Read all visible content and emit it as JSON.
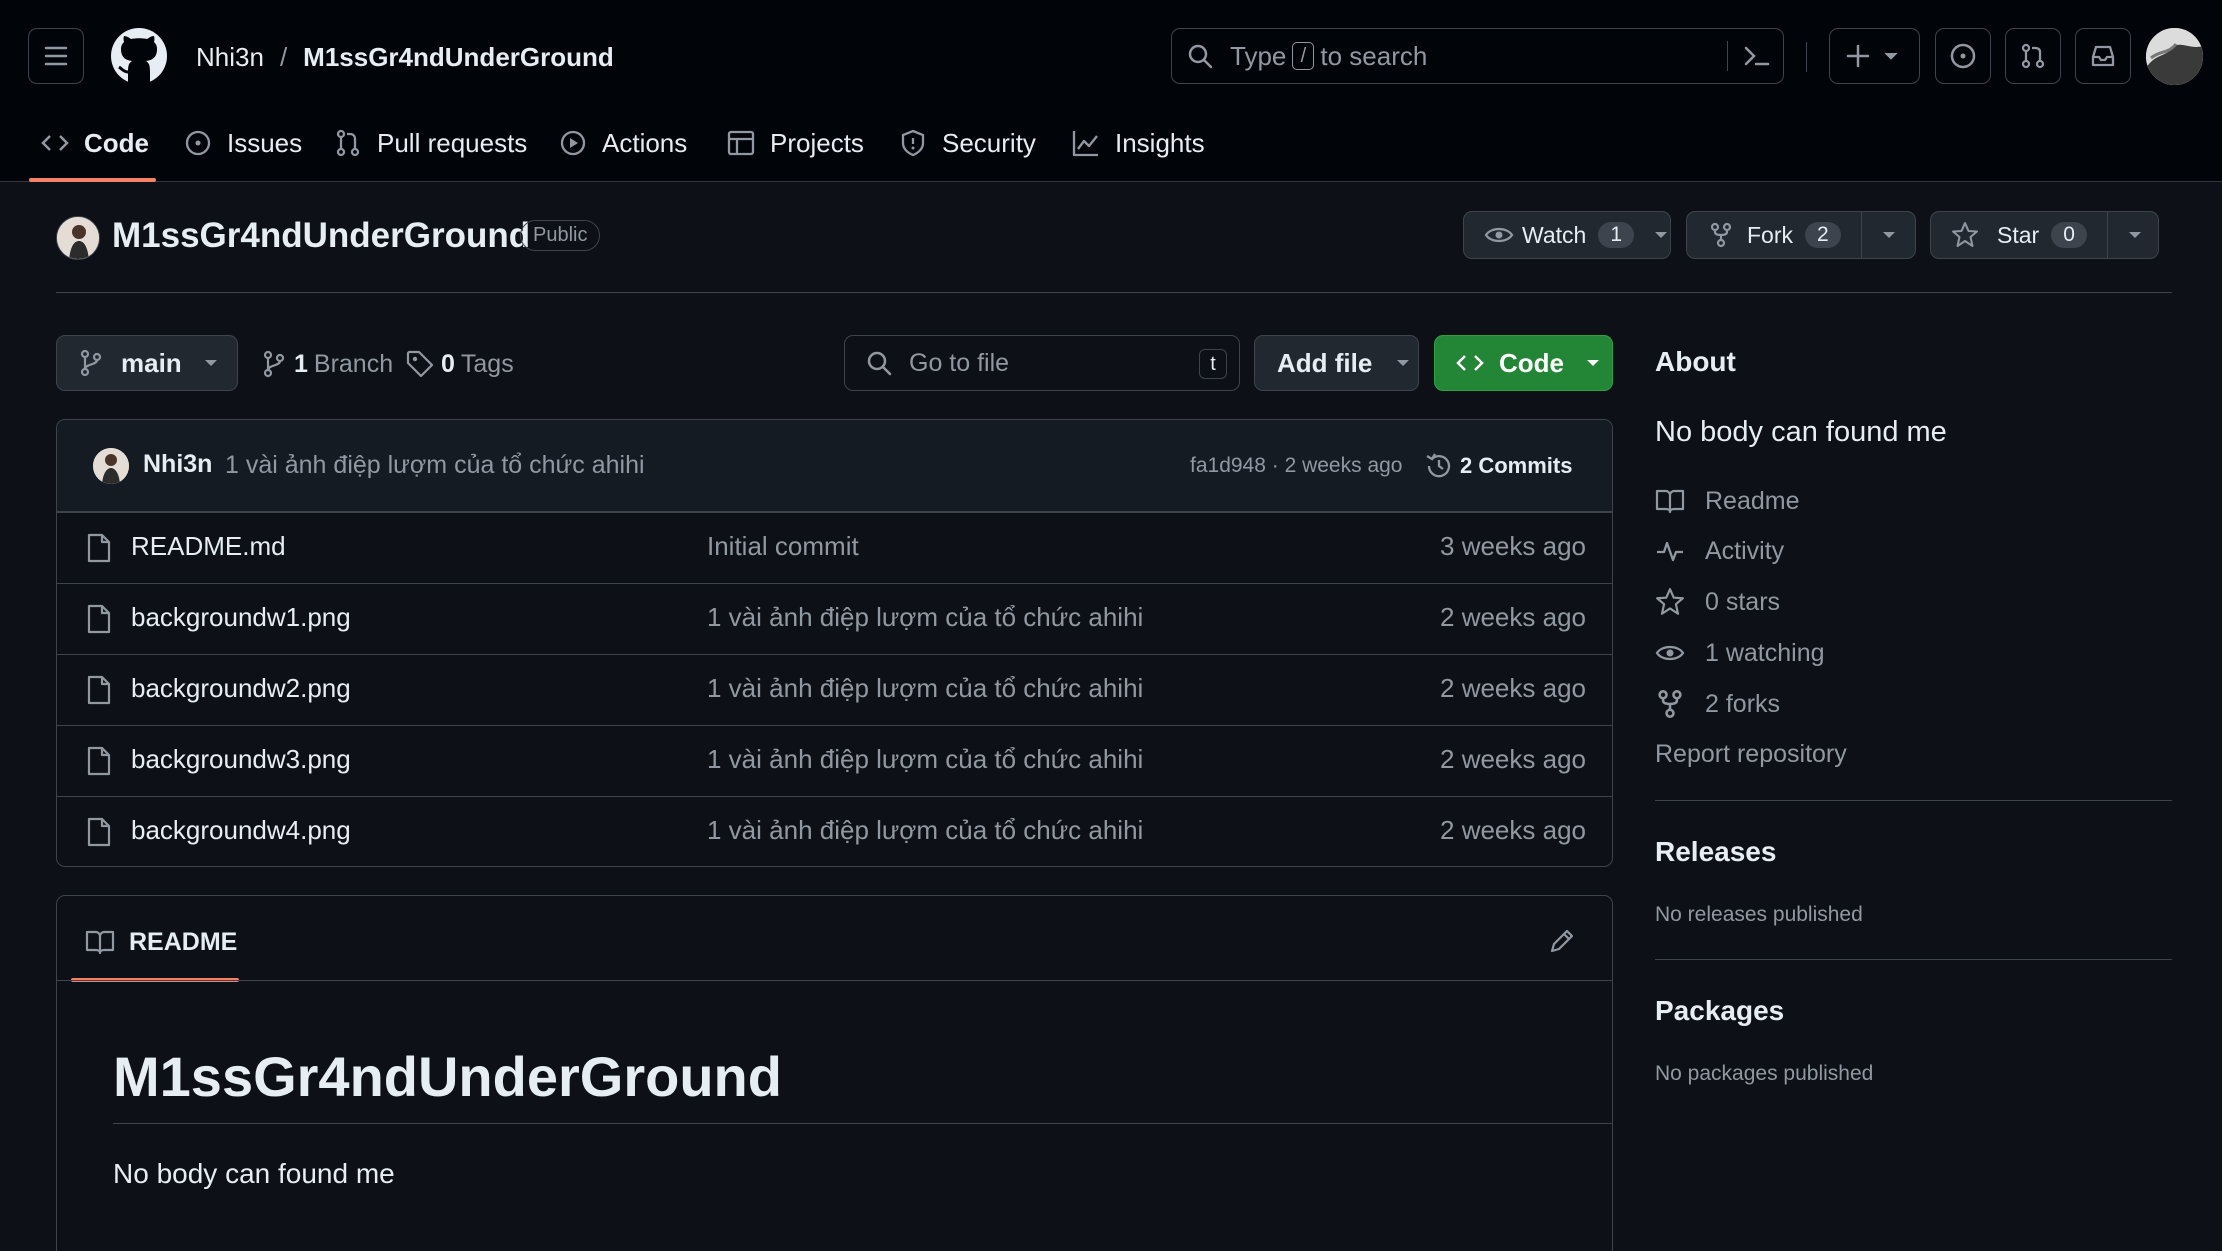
{
  "header": {
    "owner": "Nhi3n",
    "separator": "/",
    "repo": "M1ssGr4ndUnderGround",
    "search": {
      "prefix": "Type",
      "key": "/",
      "suffix": "to search"
    }
  },
  "nav": {
    "tabs": [
      {
        "label": "Code",
        "icon": "code-icon",
        "active": true
      },
      {
        "label": "Issues",
        "icon": "issue-icon"
      },
      {
        "label": "Pull requests",
        "icon": "pull-request-icon"
      },
      {
        "label": "Actions",
        "icon": "play-icon"
      },
      {
        "label": "Projects",
        "icon": "table-icon"
      },
      {
        "label": "Security",
        "icon": "shield-icon"
      },
      {
        "label": "Insights",
        "icon": "graph-icon"
      }
    ]
  },
  "repo": {
    "name": "M1ssGr4ndUnderGround",
    "visibility": "Public",
    "watch": {
      "label": "Watch",
      "count": "1"
    },
    "fork": {
      "label": "Fork",
      "count": "2"
    },
    "star": {
      "label": "Star",
      "count": "0"
    }
  },
  "toolbar": {
    "branch": "main",
    "branches_count": "1",
    "branches_label": "Branch",
    "tags_count": "0",
    "tags_label": "Tags",
    "goto_placeholder": "Go to file",
    "goto_key": "t",
    "add_file": "Add file",
    "code": "Code"
  },
  "commit": {
    "author": "Nhi3n",
    "message": "1 vài ảnh điệp lượm của tổ chức ahihi",
    "meta": "fa1d948 · 2 weeks ago",
    "commits": "2 Commits"
  },
  "files": [
    {
      "name": "README.md",
      "message": "Initial commit",
      "date": "3 weeks ago"
    },
    {
      "name": "backgroundw1.png",
      "message": "1 vài ảnh điệp lượm của tổ chức ahihi",
      "date": "2 weeks ago"
    },
    {
      "name": "backgroundw2.png",
      "message": "1 vài ảnh điệp lượm của tổ chức ahihi",
      "date": "2 weeks ago"
    },
    {
      "name": "backgroundw3.png",
      "message": "1 vài ảnh điệp lượm của tổ chức ahihi",
      "date": "2 weeks ago"
    },
    {
      "name": "backgroundw4.png",
      "message": "1 vài ảnh điệp lượm của tổ chức ahihi",
      "date": "2 weeks ago"
    }
  ],
  "readme": {
    "tab": "README",
    "heading": "M1ssGr4ndUnderGround",
    "body": "No body can found me"
  },
  "about": {
    "title": "About",
    "description": "No body can found me",
    "links": [
      {
        "label": "Readme",
        "icon": "book-icon"
      },
      {
        "label": "Activity",
        "icon": "pulse-icon"
      },
      {
        "label": "0 stars",
        "icon": "star-icon"
      },
      {
        "label": "1 watching",
        "icon": "eye-icon"
      },
      {
        "label": "2 forks",
        "icon": "fork-icon"
      }
    ],
    "report": "Report repository"
  },
  "releases": {
    "title": "Releases",
    "text": "No releases published"
  },
  "packages": {
    "title": "Packages",
    "text": "No packages published"
  },
  "colors": {
    "accent_green": "#238636",
    "tab_underline": "#f78166",
    "background": "#0d1117"
  }
}
